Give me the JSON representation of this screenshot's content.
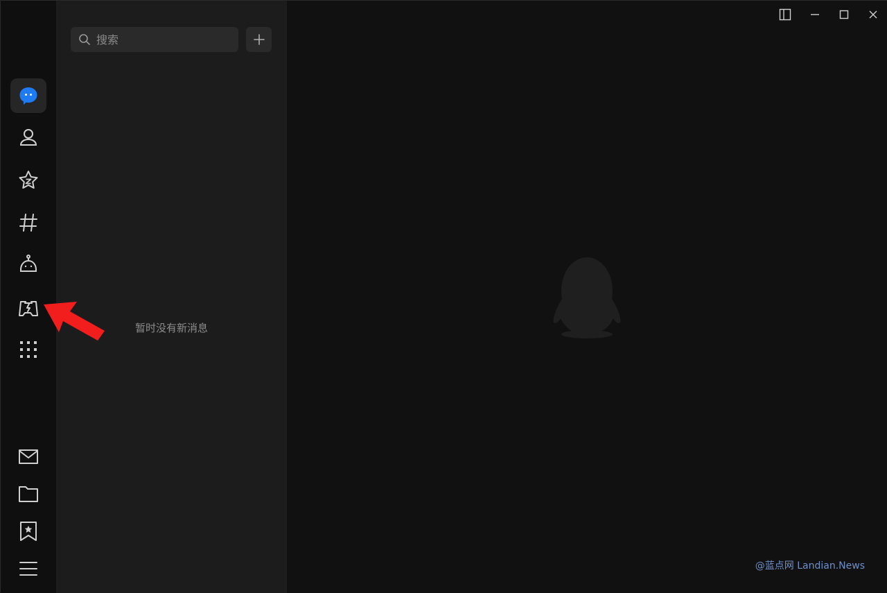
{
  "search": {
    "placeholder": "搜索"
  },
  "list": {
    "empty_message": "暂时没有新消息"
  },
  "watermark": "@蓝点网 Landian.News",
  "nav": {
    "items": [
      {
        "icon": "chat-bubble-icon",
        "active": true
      },
      {
        "icon": "contacts-icon"
      },
      {
        "icon": "qzone-star-icon"
      },
      {
        "icon": "channels-hash-icon"
      },
      {
        "icon": "robot-icon"
      },
      {
        "icon": "game-lightning-icon"
      },
      {
        "icon": "apps-grid-icon"
      },
      {
        "icon": "mail-icon"
      },
      {
        "icon": "folder-icon"
      },
      {
        "icon": "favorites-bookmark-icon"
      },
      {
        "icon": "menu-icon"
      }
    ]
  },
  "colors": {
    "accent": "#1e7bf2",
    "annotation_arrow": "#f21d1d",
    "watermark": "#6f8fc9"
  }
}
